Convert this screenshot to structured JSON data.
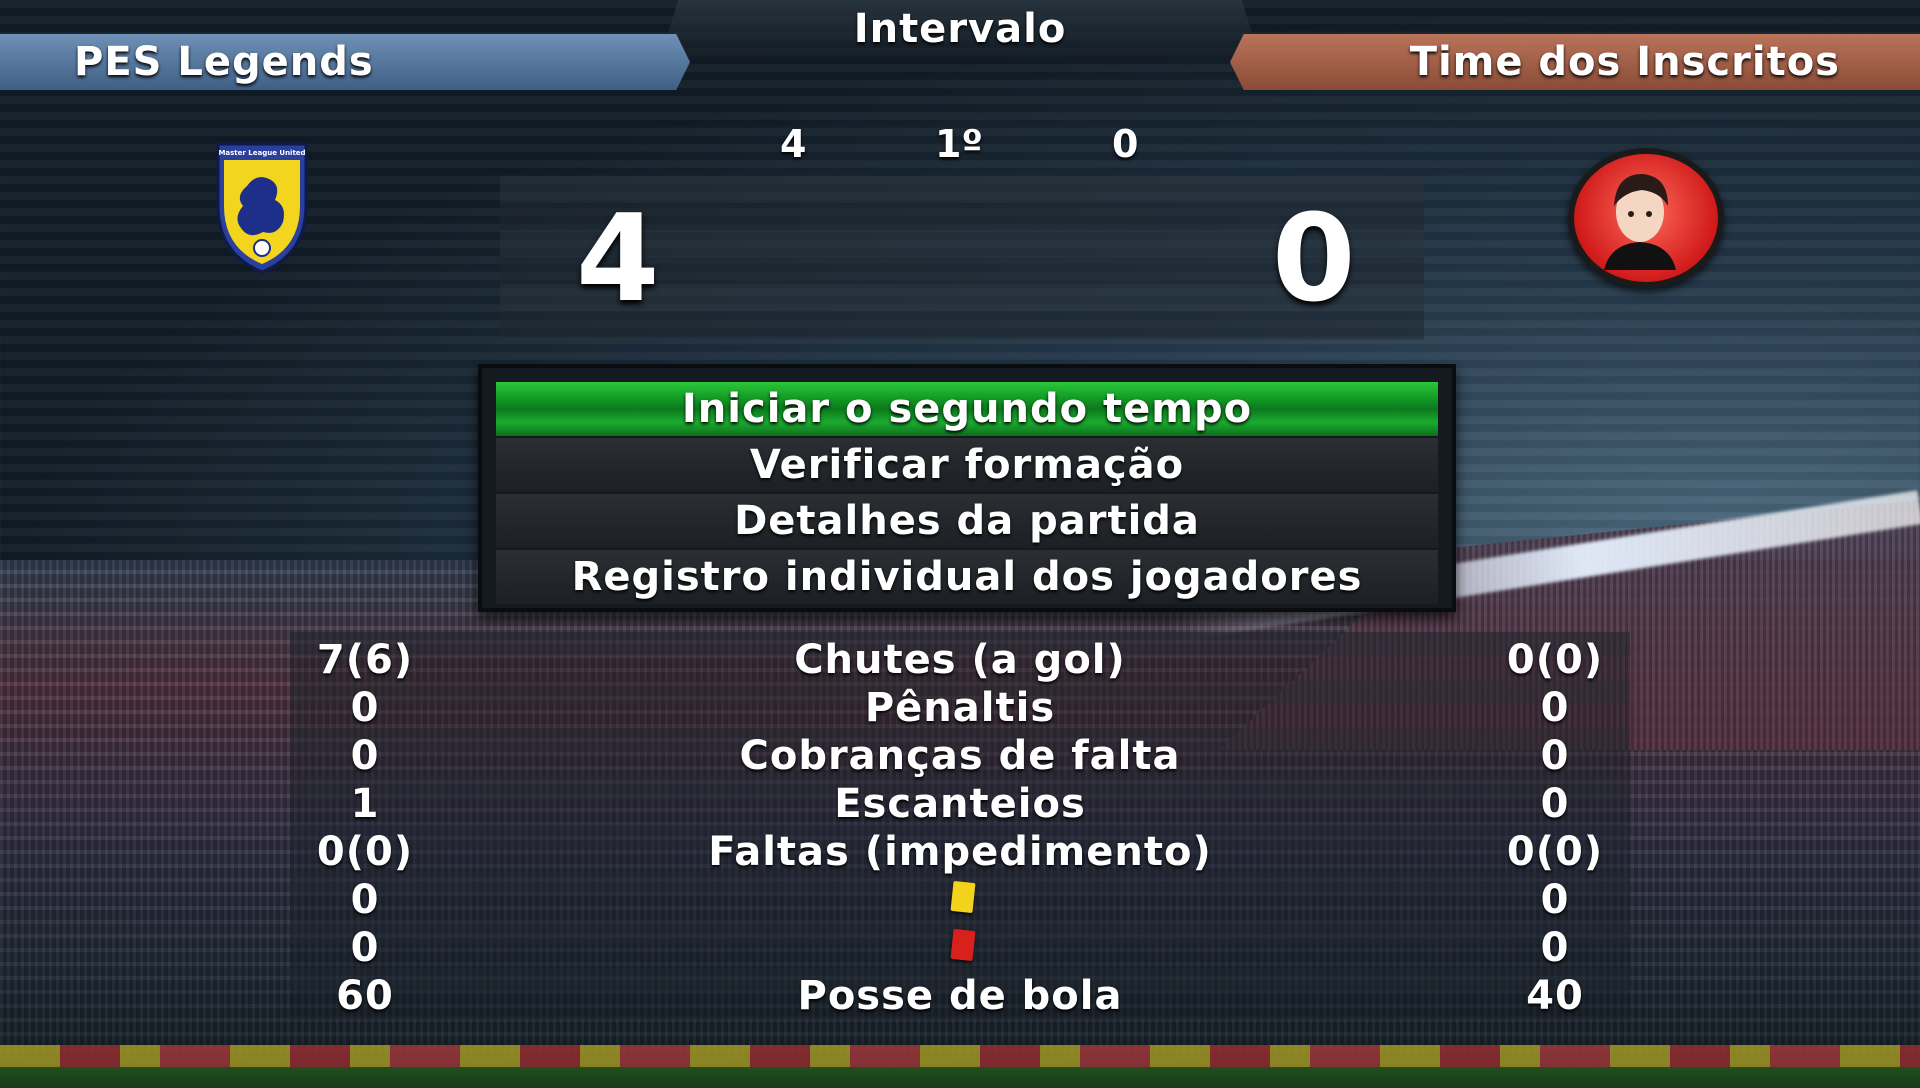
{
  "header": {
    "title": "Intervalo"
  },
  "teams": {
    "home": {
      "name": "PES Legends",
      "crest_text": "Master League United"
    },
    "away": {
      "name": "Time dos Inscritos"
    }
  },
  "score": {
    "half_home": "4",
    "period": "1º",
    "half_away": "0",
    "home": "4",
    "away": "0"
  },
  "menu": {
    "items": [
      {
        "label": "Iniciar o segundo tempo",
        "selected": true
      },
      {
        "label": "Verificar formação",
        "selected": false
      },
      {
        "label": "Detalhes da partida",
        "selected": false
      },
      {
        "label": "Registro individual dos jogadores",
        "selected": false
      }
    ]
  },
  "stats": [
    {
      "home": "7(6)",
      "label": "Chutes (a gol)",
      "away": "0(0)"
    },
    {
      "home": "0",
      "label": "Pênaltis",
      "away": "0"
    },
    {
      "home": "0",
      "label": "Cobranças de falta",
      "away": "0"
    },
    {
      "home": "1",
      "label": "Escanteios",
      "away": "0"
    },
    {
      "home": "0(0)",
      "label": "Faltas (impedimento)",
      "away": "0(0)"
    },
    {
      "home": "0",
      "icon": "yellow-card-icon",
      "away": "0"
    },
    {
      "home": "0",
      "icon": "red-card-icon",
      "away": "0"
    },
    {
      "home": "60",
      "label": "Posse de bola",
      "away": "40"
    }
  ],
  "colors": {
    "home_banner": "#5a7ca2",
    "away_banner": "#a4634a",
    "menu_selected": "#16a82a",
    "yellow_card": "#f2d21a",
    "red_card": "#d8201c"
  }
}
